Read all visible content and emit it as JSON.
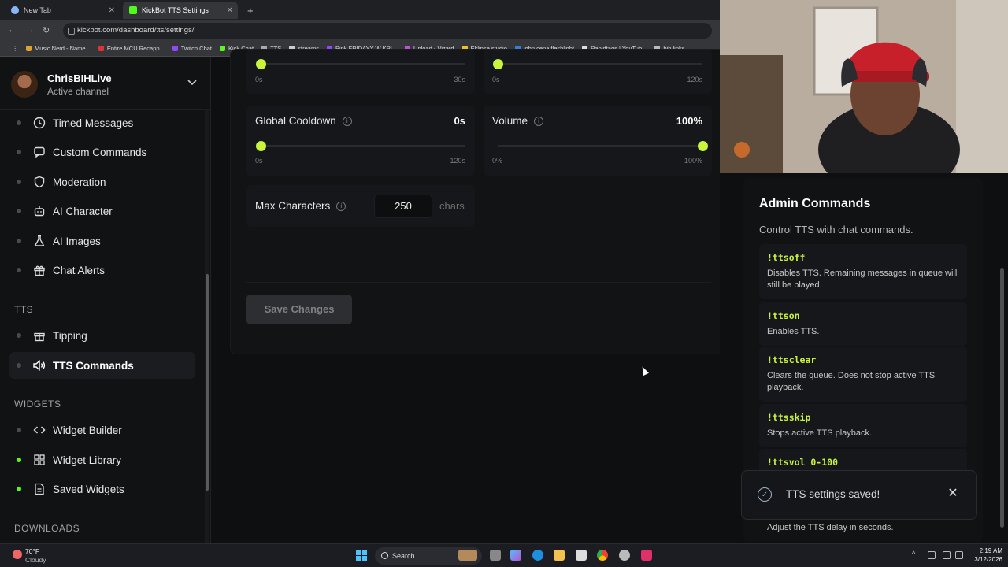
{
  "browser": {
    "tabs": [
      {
        "label": "New Tab"
      },
      {
        "label": "KickBot TTS Settings"
      }
    ],
    "url": "kickbot.com/dashboard/tts/settings/",
    "bookmarks": [
      "Music Nerd - Name...",
      "Entire MCU Recapp...",
      "Twitch Chat",
      "Kick Chat",
      "TTS",
      "streams",
      "Pink FRIDAYY W KPI...",
      "Upload - Vizard",
      "Eklipse studio",
      "john cena fleshlight",
      "Rapidtags | YouTub...",
      "bih links"
    ]
  },
  "account": {
    "name": "ChrisBIHLive",
    "subtitle": "Active channel"
  },
  "sidebar": {
    "items": [
      {
        "label": "Timed Messages"
      },
      {
        "label": "Custom Commands"
      },
      {
        "label": "Moderation"
      },
      {
        "label": "AI Character"
      },
      {
        "label": "AI Images"
      },
      {
        "label": "Chat Alerts"
      }
    ],
    "tts_section": "TTS",
    "tts_items": [
      {
        "label": "Tipping"
      },
      {
        "label": "TTS Commands"
      }
    ],
    "widgets_section": "WIDGETS",
    "widget_items": [
      {
        "label": "Widget Builder"
      },
      {
        "label": "Widget Library"
      },
      {
        "label": "Saved Widgets"
      }
    ],
    "downloads_section": "DOWNLOADS"
  },
  "settings": {
    "top_left": {
      "min": "0s",
      "max": "30s",
      "level": 0
    },
    "top_right": {
      "min": "0s",
      "max": "120s",
      "level": 0
    },
    "global_cooldown": {
      "label": "Global Cooldown",
      "value": "0s",
      "min": "0s",
      "max": "120s",
      "level": 0
    },
    "volume": {
      "label": "Volume",
      "value": "100%",
      "min": "0%",
      "max": "100%",
      "level": 1
    },
    "max_characters": {
      "label": "Max Characters",
      "value": "250",
      "unit": "chars"
    },
    "save_label": "Save Changes"
  },
  "admin": {
    "title": "Admin Commands",
    "subtitle": "Control TTS with chat commands.",
    "commands": [
      {
        "name": "!ttsoff",
        "desc": "Disables TTS. Remaining messages in queue will still be played."
      },
      {
        "name": "!ttson",
        "desc": "Enables TTS."
      },
      {
        "name": "!ttsclear",
        "desc": "Clears the queue. Does not stop active TTS playback."
      },
      {
        "name": "!ttsskip",
        "desc": "Stops active TTS playback."
      },
      {
        "name": "!ttsvol 0-100",
        "desc": ""
      }
    ],
    "trailing_desc": "Adjust the TTS delay in seconds."
  },
  "toast": {
    "text": "TTS settings saved!"
  },
  "taskbar": {
    "temp": "70°F",
    "weather": "Cloudy",
    "search": "Search",
    "time": "2:19 AM",
    "date": "3/12/2026"
  },
  "colors": {
    "accent": "#c8f53c",
    "kick_green": "#53fc18"
  }
}
